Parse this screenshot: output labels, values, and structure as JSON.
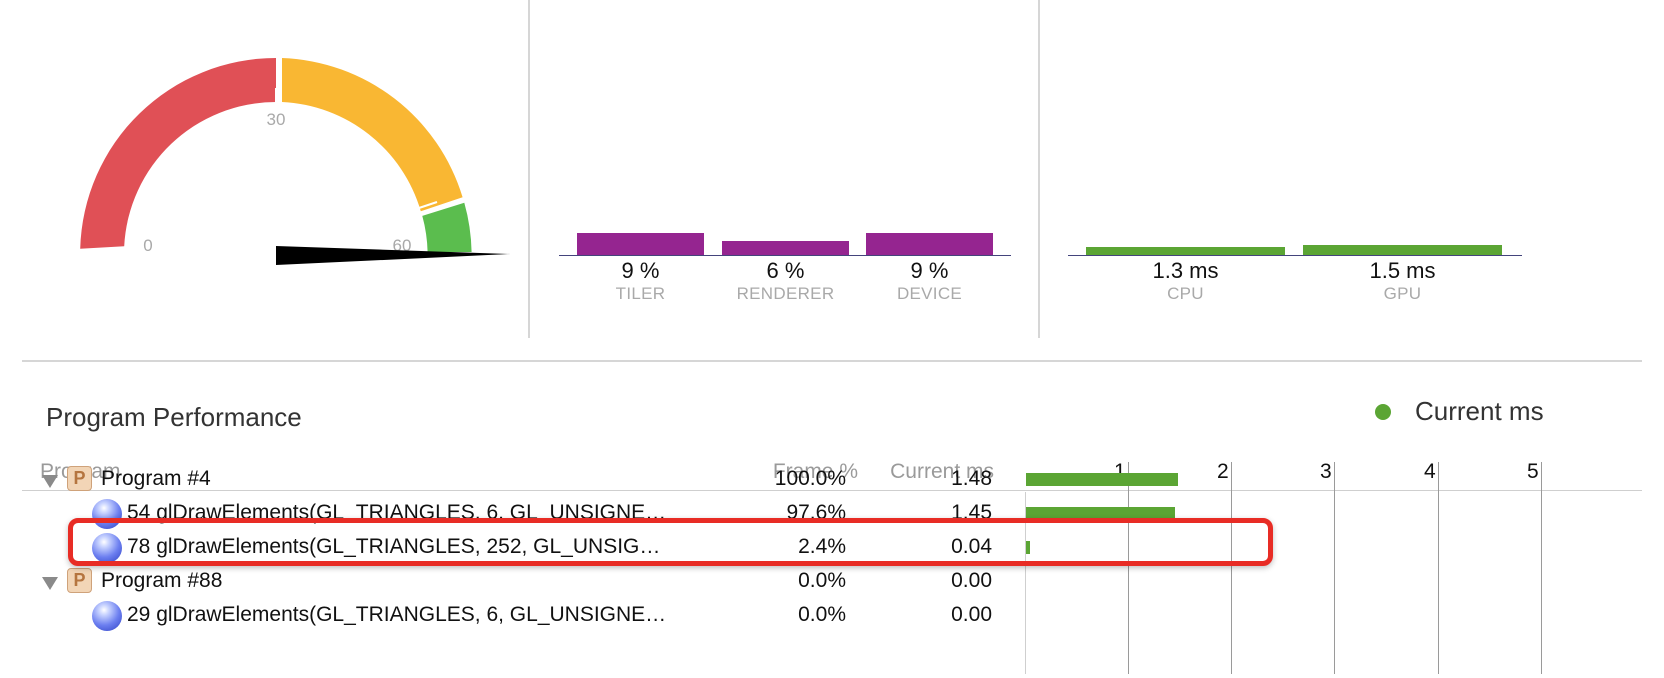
{
  "gauge": {
    "ticks": {
      "low": "0",
      "mid": "30",
      "high": "60"
    },
    "colors": {
      "red": "#e05056",
      "yellow": "#f9b733",
      "green": "#5bbd4e",
      "needle": "#000000"
    }
  },
  "utilization": {
    "bars": [
      {
        "value": "9 %",
        "label": "TILER",
        "level": 9
      },
      {
        "value": "6 %",
        "label": "RENDERER",
        "level": 6
      },
      {
        "value": "9 %",
        "label": "DEVICE",
        "level": 9
      }
    ],
    "color": "#952590"
  },
  "timing": {
    "bars": [
      {
        "value": "1.3 ms",
        "label": "CPU",
        "level": 1.3
      },
      {
        "value": "1.5 ms",
        "label": "GPU",
        "level": 1.5
      }
    ],
    "color": "#5ba534"
  },
  "program_performance": {
    "title": "Program Performance",
    "legend": {
      "label": "Current ms",
      "color": "#5ba534"
    },
    "columns": {
      "program": "Program",
      "frame": "Frame %",
      "current": "Current ms"
    },
    "axis_ticks": [
      "1",
      "2",
      "3",
      "4",
      "5"
    ],
    "rows": [
      {
        "type": "program",
        "name": "Program #4",
        "icon": "P",
        "frame": "100.0%",
        "ms": "1.48",
        "ms_value": 1.48
      },
      {
        "type": "call",
        "name": "54 glDrawElements(GL_TRIANGLES, 6, GL_UNSIGNE…",
        "frame": "97.6%",
        "ms": "1.45",
        "ms_value": 1.45
      },
      {
        "type": "call",
        "name": "78 glDrawElements(GL_TRIANGLES, 252, GL_UNSIG…",
        "frame": "2.4%",
        "ms": "0.04",
        "ms_value": 0.04
      },
      {
        "type": "program",
        "name": "Program #88",
        "icon": "P",
        "frame": "0.0%",
        "ms": "0.00",
        "ms_value": 0
      },
      {
        "type": "call",
        "name": "29 glDrawElements(GL_TRIANGLES, 6, GL_UNSIGNE…",
        "frame": "0.0%",
        "ms": "0.00",
        "ms_value": 0
      }
    ],
    "highlight_color": "#e82c25"
  }
}
